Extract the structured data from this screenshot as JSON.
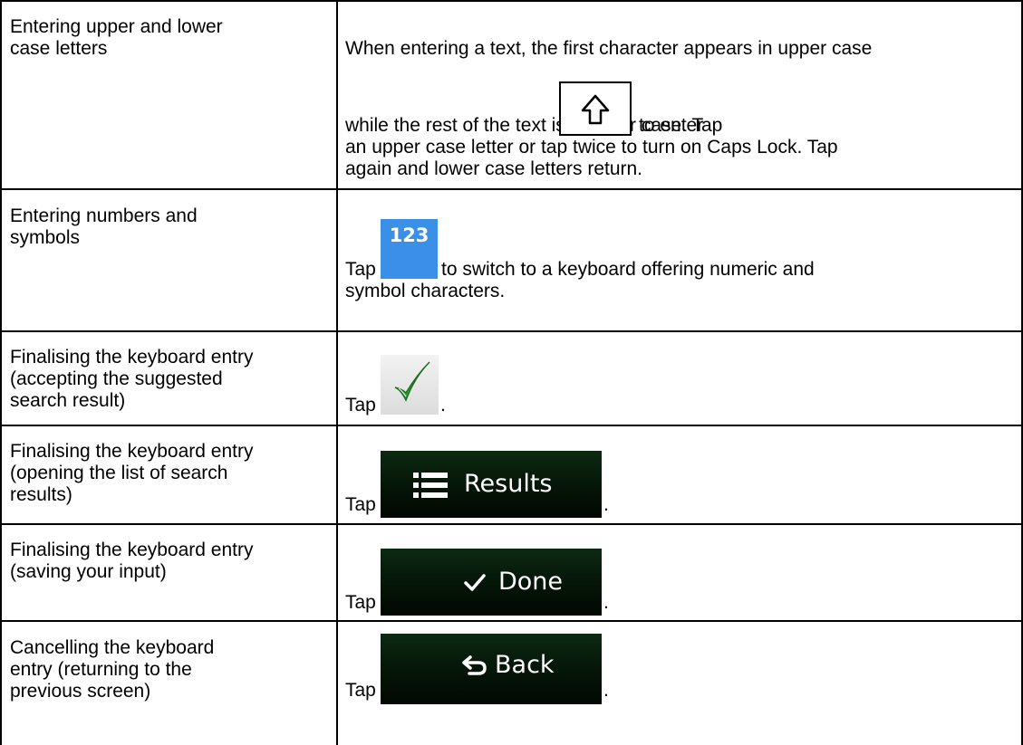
{
  "rows": [
    {
      "label_lines": [
        "Entering upper and lower",
        "case letters"
      ],
      "desc_lines": [
        "When entering a text, the first character appears in upper case",
        "while the rest of the text is in lower case. Tap",
        "to enter",
        "an upper case letter or tap twice to turn on Caps Lock. Tap",
        "again and lower case letters return."
      ],
      "icon": "shift-arrow-icon"
    },
    {
      "label_lines": [
        "Entering numbers and",
        "symbols"
      ],
      "desc_lines": [
        "Tap",
        "to switch to a keyboard offering numeric and",
        "symbol characters."
      ],
      "button_label": "123"
    },
    {
      "label_lines": [
        "Finalising the keyboard entry",
        "(accepting the suggested",
        "search result)"
      ],
      "desc_lines": [
        "Tap",
        "."
      ],
      "icon": "checkmark-icon"
    },
    {
      "label_lines": [
        "Finalising the keyboard entry",
        "(opening the list of search",
        "results)"
      ],
      "desc_lines": [
        "Tap",
        "."
      ],
      "button_label": "Results",
      "icon": "list-icon"
    },
    {
      "label_lines": [
        "Finalising the keyboard entry",
        "(saving your input)"
      ],
      "desc_lines": [
        "Tap",
        "."
      ],
      "button_label": "Done",
      "icon": "check-icon"
    },
    {
      "label_lines": [
        "Cancelling the keyboard",
        "entry (returning to the",
        "previous screen)"
      ],
      "desc_lines": [
        "Tap",
        "."
      ],
      "button_label": "Back",
      "icon": "back-arrow-icon"
    }
  ],
  "colors": {
    "blue_button": "#3a8fe6",
    "dark_button": "#061809"
  }
}
